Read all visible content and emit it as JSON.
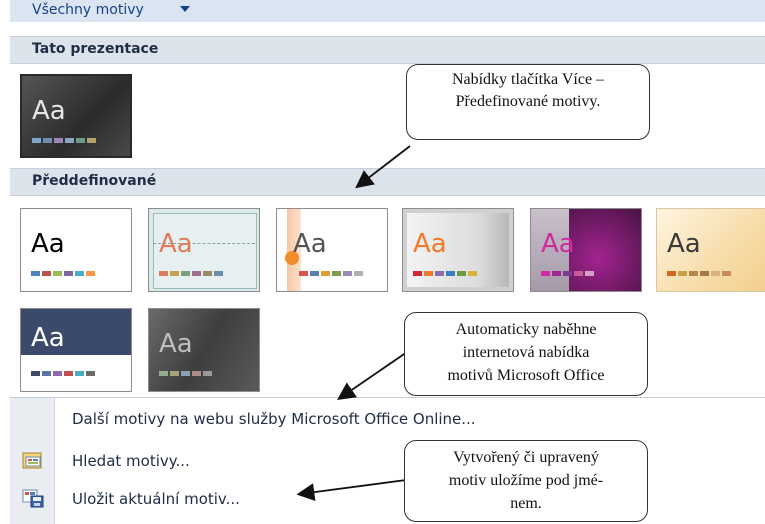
{
  "filter": {
    "label": "Všechny motivy"
  },
  "sections": {
    "this_presentation": "Tato prezentace",
    "predefined": "Předdefinované"
  },
  "tile_text": "Aa",
  "menu": {
    "more_online": "Další motivy na webu služby Microsoft Office Online...",
    "browse": "Hledat motivy...",
    "save_current": "Uložit aktuální motiv..."
  },
  "callouts": {
    "more_button": [
      "Nabídky tlačítka Více –",
      "Předefinované motivy."
    ],
    "online": [
      "Automaticky naběhne",
      "internetová nabídka",
      "motivů Microsoft Office"
    ],
    "save": [
      "Vytvořený či upravený",
      "motiv uložíme pod jmé-",
      "nem."
    ]
  },
  "colors": {
    "accent": "#15428b",
    "header_bg": "#dde3ea",
    "filter_bg": "#dbe5f1"
  }
}
